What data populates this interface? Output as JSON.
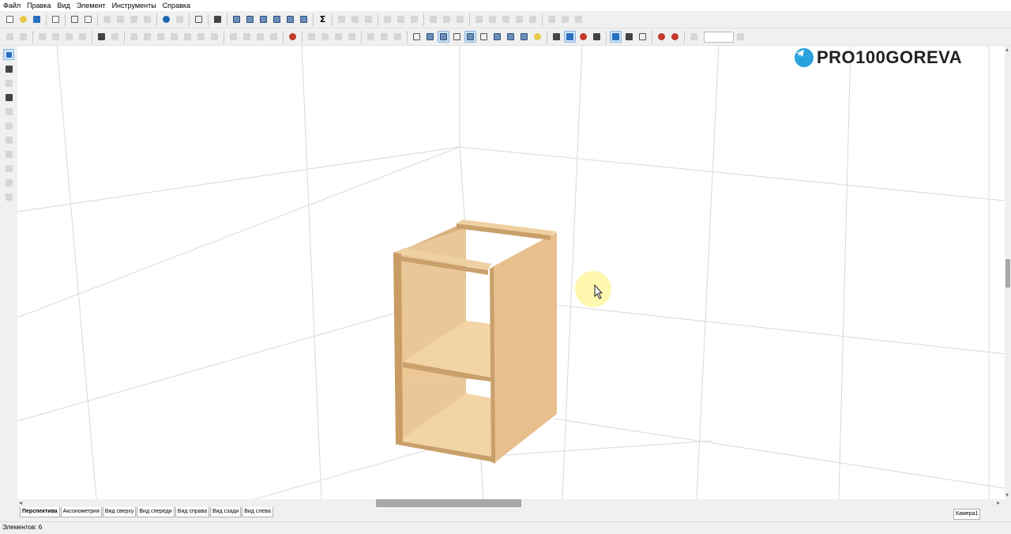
{
  "menu": {
    "items": [
      "Файл",
      "Правка",
      "Вид",
      "Элемент",
      "Инструменты",
      "Справка"
    ]
  },
  "logo": {
    "text": "PRO100GOREVA",
    "icon": "telegram-icon",
    "color": "#2aa3dd"
  },
  "view_tabs": [
    "Перспектива",
    "Аксонометрия",
    "Вид сверху",
    "Вид спереди",
    "Вид справа",
    "Вид сзади",
    "Вид слева"
  ],
  "camera_tab": "Камера1",
  "status": {
    "elements_text": "Элементов: 6"
  },
  "colors": {
    "wood_light": "#f0d3a6",
    "wood_mid": "#e8c291",
    "wood_edge": "#c9a06b",
    "selection_active": "#cde4f7"
  }
}
